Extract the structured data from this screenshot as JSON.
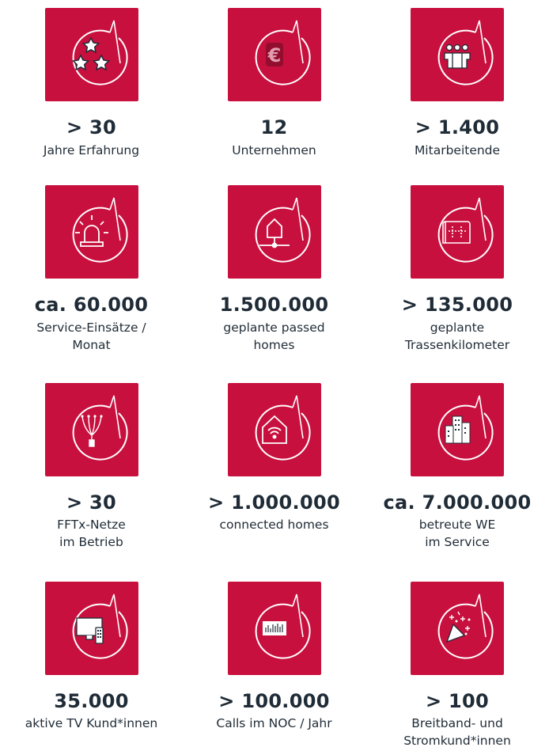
{
  "items": [
    {
      "icon": "stars-icon",
      "value": "> 30",
      "label": "Jahre Erfahrung"
    },
    {
      "icon": "euro-icon",
      "value": "12",
      "label": "Unternehmen"
    },
    {
      "icon": "team-icon",
      "value": "> 1.400",
      "label": "Mitarbeitende"
    },
    {
      "icon": "siren-icon",
      "value": "ca. 60.000",
      "label": "Service-Einsätze /\nMonat"
    },
    {
      "icon": "house-connection-icon",
      "value": "1.500.000",
      "label": "geplante passed\nhomes"
    },
    {
      "icon": "map-plan-icon",
      "value": "> 135.000",
      "label": "geplante\nTrassenkilometer"
    },
    {
      "icon": "fiber-icon",
      "value": "> 30",
      "label": "FFTx-Netze\nim Betrieb"
    },
    {
      "icon": "wifi-house-icon",
      "value": "> 1.000.000",
      "label": "connected homes"
    },
    {
      "icon": "buildings-icon",
      "value": "ca. 7.000.000",
      "label": "betreute WE\nim Service"
    },
    {
      "icon": "tv-remote-icon",
      "value": "35.000",
      "label": "aktive TV Kund*innen"
    },
    {
      "icon": "server-icon",
      "value": "> 100.000",
      "label": "Calls im NOC / Jahr"
    },
    {
      "icon": "party-popper-icon",
      "value": "> 100",
      "label": "Breitband- und\nStromkund*innen"
    }
  ],
  "colors": {
    "tile": "#c8103e",
    "text": "#1f2b36",
    "icon": "#ffffff"
  }
}
